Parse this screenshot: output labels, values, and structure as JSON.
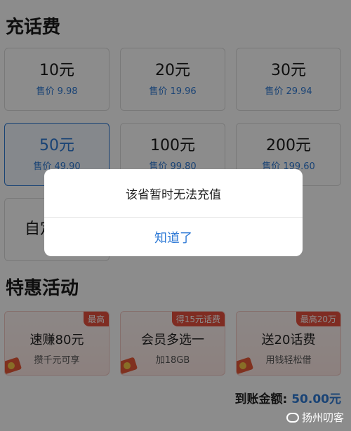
{
  "topup": {
    "title": "充话费",
    "options": [
      {
        "amount": "10元",
        "price": "售价 9.98"
      },
      {
        "amount": "20元",
        "price": "售价 19.96"
      },
      {
        "amount": "30元",
        "price": "售价 29.94"
      },
      {
        "amount": "50元",
        "price": "售价 49.90"
      },
      {
        "amount": "100元",
        "price": "售价 99.80"
      },
      {
        "amount": "200元",
        "price": "售价 199.60"
      }
    ],
    "custom_label": "自定",
    "selected_index": 3
  },
  "promos": {
    "title": "特惠活动",
    "items": [
      {
        "badge": "最高",
        "main": "速赚80元",
        "sub": "攒千元可享"
      },
      {
        "badge": "得15元话费",
        "main": "会员多选一",
        "sub": "加18GB"
      },
      {
        "badge": "最高20万",
        "main": "送20话费",
        "sub": "用钱轻松借"
      }
    ]
  },
  "summary": {
    "label": "到账金额: ",
    "value": "50.00元"
  },
  "dialog": {
    "message": "该省暂时无法充值",
    "confirm_label": "知道了"
  },
  "watermark": {
    "text": "扬州叨客"
  },
  "colors": {
    "accent": "#2f7ad6",
    "badge": "#e8503f"
  }
}
